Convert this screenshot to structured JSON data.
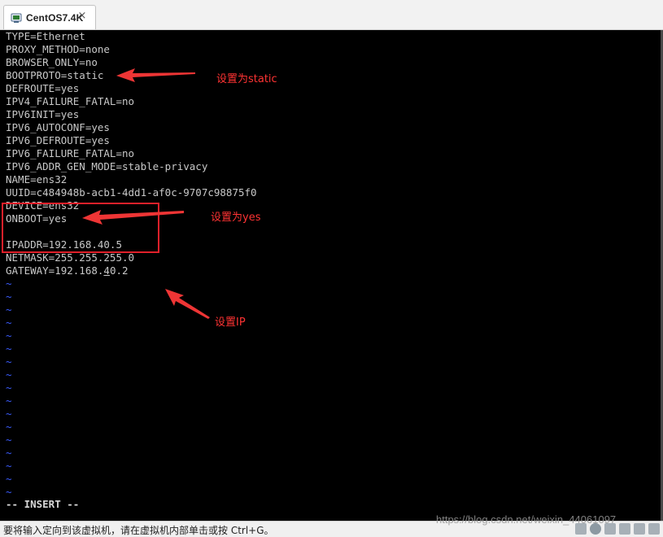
{
  "tab": {
    "title": "CentOS7.4K",
    "close_glyph": "×",
    "icon": "vm-icon"
  },
  "terminal": {
    "lines": [
      "TYPE=Ethernet",
      "PROXY_METHOD=none",
      "BROWSER_ONLY=no",
      "BOOTPROTO=static",
      "DEFROUTE=yes",
      "IPV4_FAILURE_FATAL=no",
      "IPV6INIT=yes",
      "IPV6_AUTOCONF=yes",
      "IPV6_DEFROUTE=yes",
      "IPV6_FAILURE_FATAL=no",
      "IPV6_ADDR_GEN_MODE=stable-privacy",
      "NAME=ens32",
      "UUID=c484948b-acb1-4dd1-af0c-9707c98875f0",
      "DEVICE=ens32",
      "ONBOOT=yes",
      "",
      "IPADDR=192.168.40.5",
      "NETMASK=255.255.255.0"
    ],
    "gateway": {
      "prefix": "GATEWAY=192.168.",
      "cursor_char": "4",
      "suffix": "0.2"
    },
    "tilde": "~",
    "tilde_count": 17,
    "mode": "-- INSERT --"
  },
  "annotations": {
    "bootproto": "设置为static",
    "onboot": "设置为yes",
    "ip": "设置IP",
    "color": "#ff3333"
  },
  "statusbar": {
    "text": "要将输入定向到该虚拟机，请在虚拟机内部单击或按 Ctrl+G。",
    "watermark": "https://blog.csdn.net/weixin_44061097"
  }
}
